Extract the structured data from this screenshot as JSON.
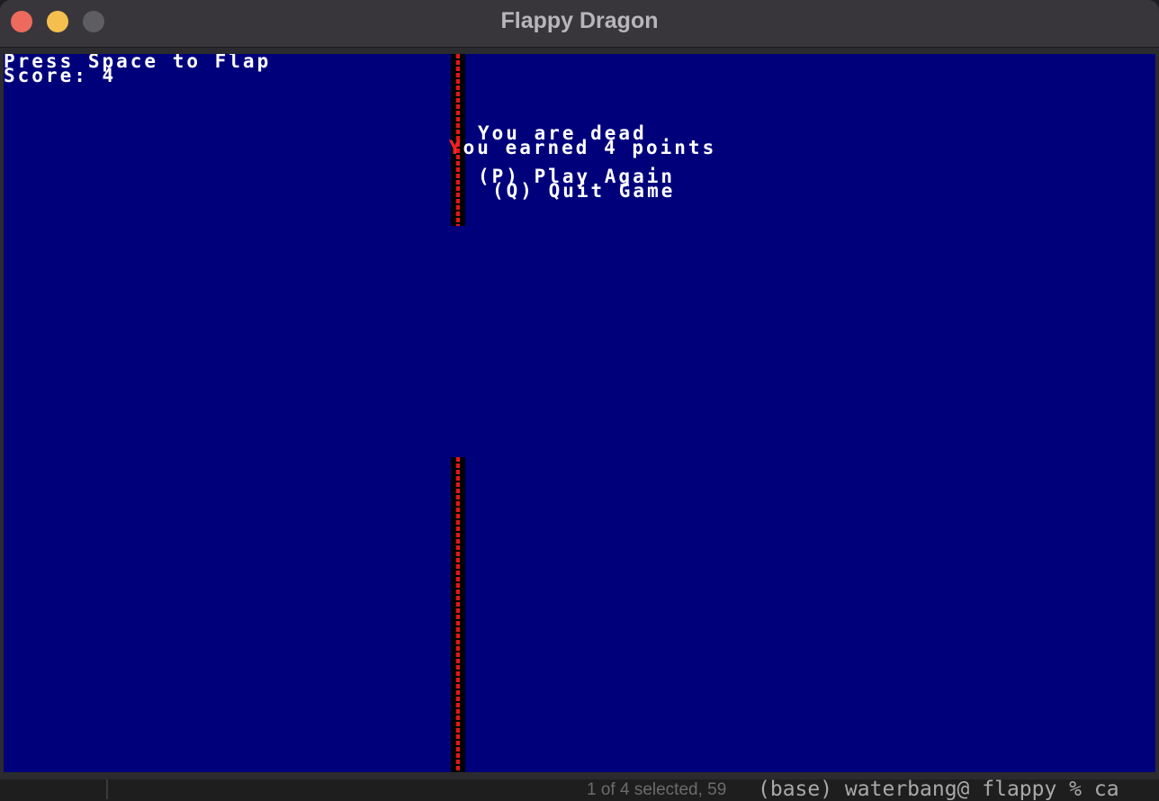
{
  "window": {
    "title": "Flappy Dragon"
  },
  "hud": {
    "instruction": "Press Space to Flap",
    "score_line": "Score: 4"
  },
  "game_over": {
    "dead_text": "You are dead",
    "earned_text": "You earned 4 points",
    "play_again": "(P) Play Again",
    "quit": "(Q) Quit Game"
  },
  "player": {
    "glyph": "Y",
    "color": "#ff1a1a"
  },
  "colors": {
    "background": "#00007b",
    "text": "#ffffff",
    "obstacle": "#e81616"
  },
  "background_terminal": {
    "status": "1 of 4 selected, 59",
    "command": "(base) waterbang@ flappy % ca"
  }
}
